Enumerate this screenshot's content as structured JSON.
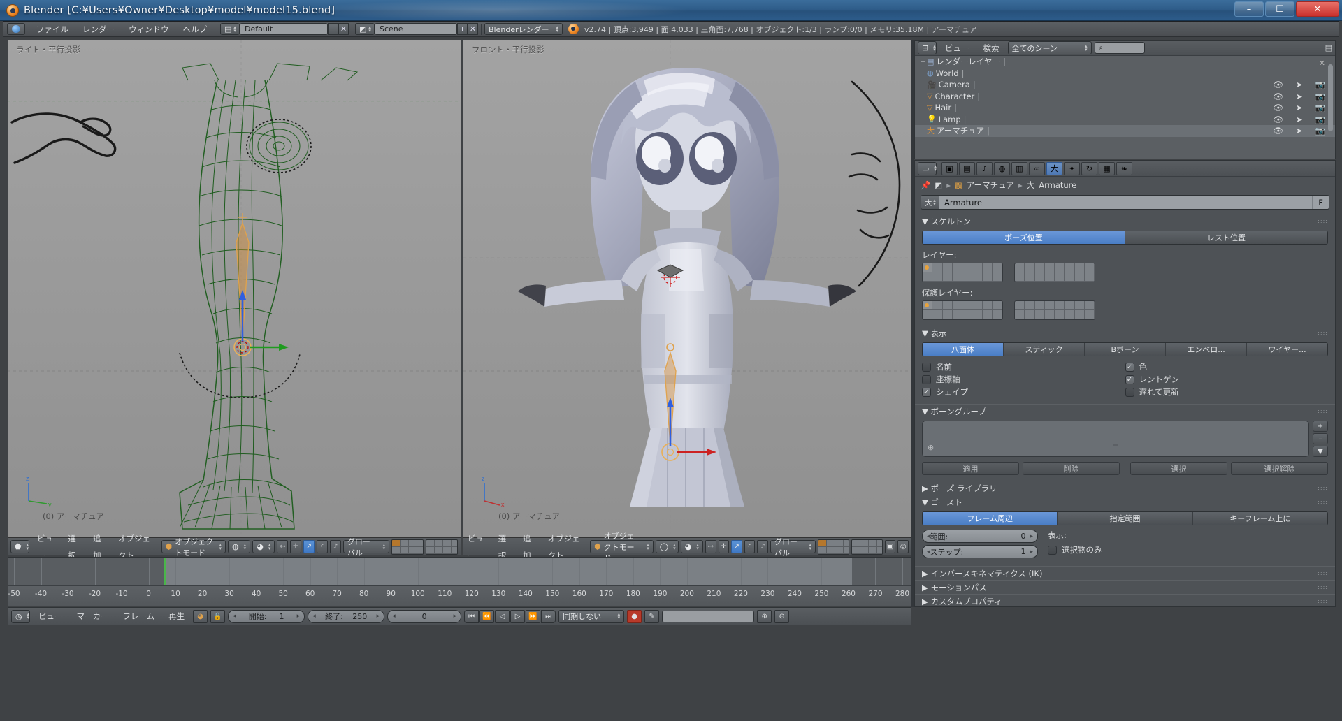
{
  "window": {
    "title": "Blender  [C:¥Users¥Owner¥Desktop¥model¥model15.blend]",
    "minimize": "–",
    "maximize": "☐",
    "close": "✕"
  },
  "topbar": {
    "menus": [
      "ファイル",
      "レンダー",
      "ウィンドウ",
      "ヘルプ"
    ],
    "screen_layout": "Default",
    "scene_name": "Scene",
    "render_engine": "Blenderレンダー",
    "info": "v2.74 | 頂点:3,949 | 面:4,033 | 三角面:7,768 | オブジェクト:1/3 | ランプ:0/0 | メモリ:35.18M | アーマチュア",
    "add_label": "+",
    "remove_label": "✕"
  },
  "viewport_left": {
    "view_label": "ライト・平行投影",
    "object_label": "(0) アーマチュア",
    "axis_z": "z",
    "axis_y": "y",
    "header": {
      "menus": [
        "ビュー",
        "選択",
        "追加",
        "オブジェクト"
      ],
      "mode": "オブジェクトモード",
      "transform_orientation": "グローバル"
    }
  },
  "viewport_right": {
    "view_label": "フロント・平行投影",
    "object_label": "(0) アーマチュア",
    "axis_z": "z",
    "axis_x": "x",
    "header": {
      "menus": [
        "ビュー",
        "選択",
        "追加",
        "オブジェクト"
      ],
      "mode": "オブジェクトモード",
      "transform_orientation": "グローバル"
    }
  },
  "timeline": {
    "ticks": [
      "-50",
      "-40",
      "-30",
      "-20",
      "-10",
      "0",
      "10",
      "20",
      "30",
      "40",
      "50",
      "60",
      "70",
      "80",
      "90",
      "100",
      "110",
      "120",
      "130",
      "140",
      "150",
      "160",
      "170",
      "180",
      "190",
      "200",
      "210",
      "220",
      "230",
      "240",
      "250",
      "260",
      "270",
      "280"
    ],
    "current_frame": "0",
    "menus": [
      "ビュー",
      "マーカー",
      "フレーム",
      "再生"
    ],
    "start_label": "開始:",
    "start_value": "1",
    "end_label": "終了:",
    "end_value": "250",
    "frame_value": "0",
    "sync_mode": "同期しない",
    "transport": [
      "⏮",
      "⏪",
      "◁",
      "▷",
      "⏩",
      "⏭"
    ]
  },
  "outliner": {
    "view_menu": "ビュー",
    "search_menu": "検索",
    "scene_filter": "全てのシーン",
    "search_placeholder": "",
    "rows": [
      {
        "name": "レンダーレイヤー",
        "expand": "＋",
        "icon": "render-layers-icon",
        "selected": false,
        "has_right": false
      },
      {
        "name": "World",
        "expand": "",
        "icon": "world-icon",
        "selected": false,
        "has_right": false
      },
      {
        "name": "Camera",
        "expand": "＋",
        "icon": "camera-icon",
        "selected": false,
        "has_right": true
      },
      {
        "name": "Character",
        "expand": "＋",
        "icon": "mesh-icon",
        "selected": false,
        "has_right": true
      },
      {
        "name": "Hair",
        "expand": "＋",
        "icon": "mesh-icon",
        "selected": false,
        "has_right": true
      },
      {
        "name": "Lamp",
        "expand": "＋",
        "icon": "lamp-icon",
        "selected": false,
        "has_right": true
      },
      {
        "name": "アーマチュア",
        "expand": "＋",
        "icon": "armature-icon",
        "selected": true,
        "has_right": true
      }
    ]
  },
  "properties": {
    "tabs": [
      {
        "name": "render-tab",
        "glyph": "▣",
        "active": false
      },
      {
        "name": "render-layers-tab",
        "glyph": "▤",
        "active": false
      },
      {
        "name": "scene-tab",
        "glyph": "♪",
        "active": false
      },
      {
        "name": "world-tab",
        "glyph": "◍",
        "active": false
      },
      {
        "name": "object-tab",
        "glyph": "▥",
        "active": false
      },
      {
        "name": "constraints-tab",
        "glyph": "∞",
        "active": false
      },
      {
        "name": "armature-data-tab",
        "glyph": "大",
        "active": true
      },
      {
        "name": "bone-tab",
        "glyph": "✦",
        "active": false
      },
      {
        "name": "bone-constraint-tab",
        "glyph": "↻",
        "active": false
      },
      {
        "name": "texture-tab",
        "glyph": "▦",
        "active": false
      },
      {
        "name": "physics-tab",
        "glyph": "❧",
        "active": false
      }
    ],
    "breadcrumb": {
      "object": "アーマチュア",
      "data": "Armature",
      "sep": "▸"
    },
    "id_name": "Armature",
    "id_suffix": "F",
    "skeleton": {
      "title": "スケルトン",
      "pose_position": "ポーズ位置",
      "rest_position": "レスト位置",
      "layers_label": "レイヤー:",
      "protected_layers_label": "保護レイヤー:"
    },
    "display": {
      "title": "表示",
      "modes": [
        "八面体",
        "スティック",
        "Bボーン",
        "エンベロ...",
        "ワイヤー..."
      ],
      "active_mode": "八面体",
      "options_left": [
        {
          "label": "名前",
          "checked": false
        },
        {
          "label": "座標軸",
          "checked": false
        },
        {
          "label": "シェイプ",
          "checked": true
        }
      ],
      "options_right": [
        {
          "label": "色",
          "checked": true
        },
        {
          "label": "レントゲン",
          "checked": true
        },
        {
          "label": "遅れて更新",
          "checked": false
        }
      ]
    },
    "bone_groups": {
      "title": "ボーングループ",
      "buttons": [
        "適用",
        "削除",
        "選択",
        "選択解除"
      ],
      "add": "+",
      "remove": "–",
      "menu": "▼"
    },
    "pose_library": {
      "title": "ポーズ ライブラリ"
    },
    "ghost": {
      "title": "ゴースト",
      "modes": [
        "フレーム周辺",
        "指定範囲",
        "キーフレーム上に"
      ],
      "active_mode": "フレーム周辺",
      "range_label": "範囲:",
      "range_value": "0",
      "step_label": "ステップ:",
      "step_value": "1",
      "show_label": "表示:",
      "only_selected": {
        "label": "選択物のみ",
        "checked": false
      }
    },
    "ik": {
      "title": "インバースキネマティクス (IK)"
    },
    "motion_paths": {
      "title": "モーションパス"
    },
    "custom_props": {
      "title": "カスタムプロパティ"
    }
  },
  "colors": {
    "accent_blue": "#4a7ec6",
    "panel_bg": "#4e5256",
    "header_bg": "#4c5054",
    "viewport_bg": "#9a9a9a",
    "wire_green": "#1d5c1d",
    "bone_orange": "#e8a33d"
  }
}
